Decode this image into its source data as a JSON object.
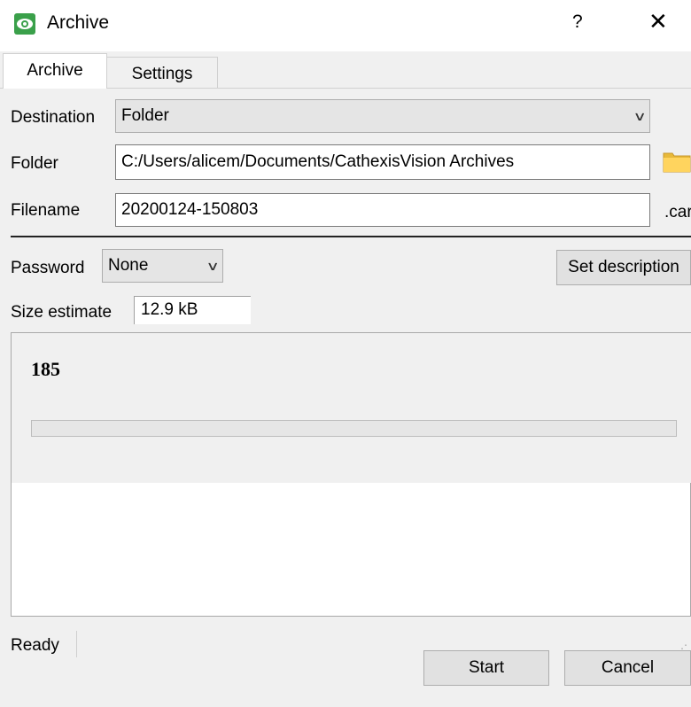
{
  "window": {
    "title": "Archive",
    "help_label": "?",
    "close_label": "✕",
    "app_icon": "eye-icon"
  },
  "tabs": [
    {
      "label": "Archive",
      "active": true
    },
    {
      "label": "Settings",
      "active": false
    }
  ],
  "form": {
    "destination_label": "Destination",
    "destination_value": "Folder",
    "folder_label": "Folder",
    "folder_value": "C:/Users/alicem/Documents/CathexisVision Archives",
    "folder_icon": "folder-icon",
    "filename_label": "Filename",
    "filename_value": "20200124-150803",
    "extension": ".car",
    "password_label": "Password",
    "password_value": "None",
    "set_description_label": "Set description",
    "size_label": "Size estimate",
    "size_value": "12.9 kB"
  },
  "progress": {
    "number": "185",
    "fraction": 0.0
  },
  "status": {
    "text": "Ready"
  },
  "buttons": {
    "start": "Start",
    "cancel": "Cancel"
  },
  "colors": {
    "progress_fill": "#06b025",
    "app_icon": "#3aa04a"
  }
}
